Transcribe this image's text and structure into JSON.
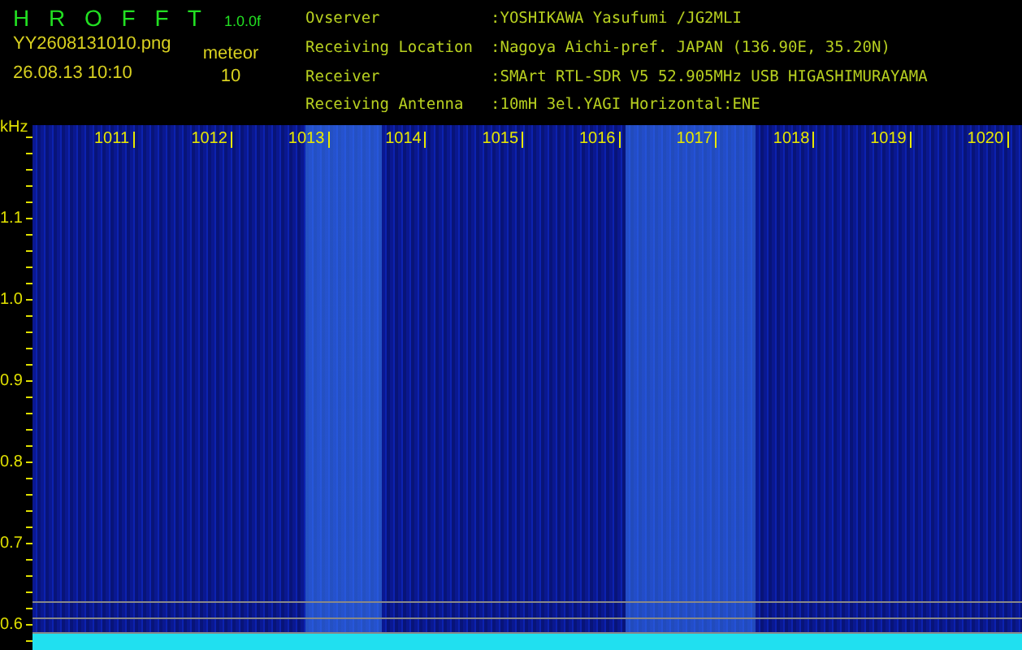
{
  "header": {
    "title": "H R O F F T",
    "version": "1.0.0f",
    "filename": "YY2608131010.png",
    "timestamp": "26.08.13 10:10",
    "mode": "meteor",
    "count": "10"
  },
  "info": [
    {
      "label": "Ovserver",
      "value": ":YOSHIKAWA Yasufumi /JG2MLI"
    },
    {
      "label": "Receiving Location",
      "value": ":Nagoya Aichi-pref. JAPAN (136.90E, 35.20N)"
    },
    {
      "label": "Receiver",
      "value": ":SMArt RTL-SDR V5 52.905MHz USB HIGASHIMURAYAMA"
    },
    {
      "label": "Receiving Antenna",
      "value": ":10mH 3el.YAGI Horizontal:ENE"
    }
  ],
  "spectrogram": {
    "unit": "kHz",
    "x_labels": [
      "1011",
      "1012",
      "1013",
      "1014",
      "1015",
      "1016",
      "1017",
      "1018",
      "1019",
      "1020"
    ],
    "y_labels": [
      "1.1",
      "1.0",
      "0.9",
      "0.8",
      "0.7",
      "0.6"
    ]
  }
}
